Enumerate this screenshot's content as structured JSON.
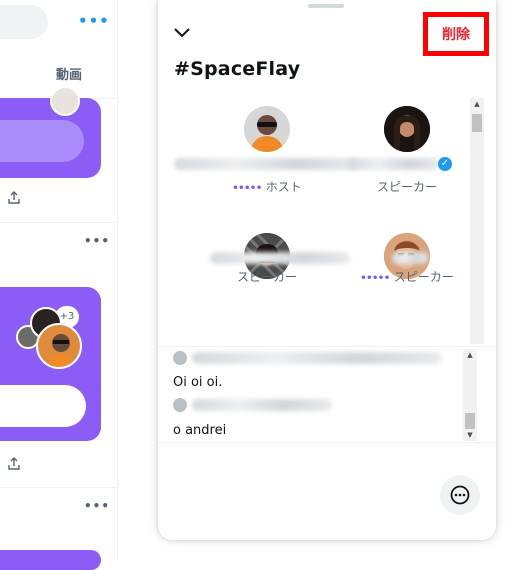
{
  "background": {
    "tab_label": "動画",
    "plus_count": "+3"
  },
  "space": {
    "title": "#SpaceFlay",
    "delete_label": "削除",
    "speakers": [
      {
        "role": "ホスト",
        "verified": false
      },
      {
        "role": "スピーカー",
        "verified": true
      },
      {
        "role": "スピーカー",
        "verified": false
      },
      {
        "role": "スピーカー",
        "verified": false
      }
    ]
  },
  "chat": {
    "messages": [
      {
        "text": "Oi oi oi."
      },
      {
        "text": "o andrei"
      }
    ]
  },
  "colors": {
    "accent_purple": "#7856ff",
    "card_purple": "#8b5cf6",
    "delete_red": "#f4212e",
    "highlight_red": "#ff0000",
    "verified_blue": "#1d9bf0"
  }
}
